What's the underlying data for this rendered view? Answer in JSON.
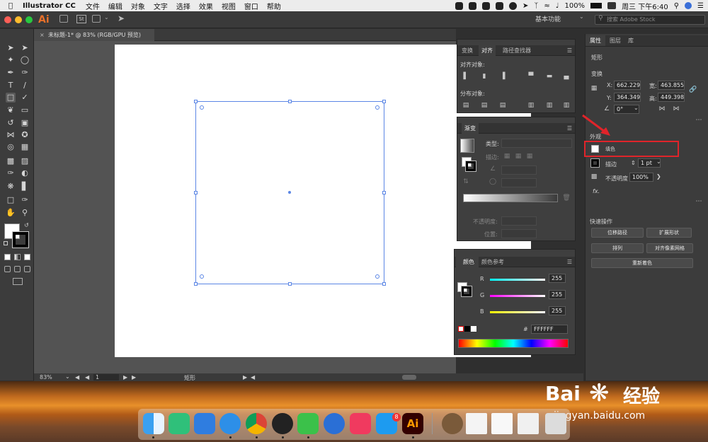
{
  "menubar": {
    "app": "Illustrator CC",
    "items": [
      "文件",
      "编辑",
      "对象",
      "文字",
      "选择",
      "效果",
      "视图",
      "窗口",
      "帮助"
    ],
    "battery": "100%",
    "clock": "周三 下午6:40"
  },
  "titlebar": {
    "ai_logo": "Ai",
    "st_logo": "St",
    "workspace": "基本功能",
    "stock_search_placeholder": "搜索 Adobe Stock"
  },
  "document": {
    "tab_label": "未标题-1* @ 83% (RGB/GPU 预览)",
    "close": "×"
  },
  "status": {
    "zoom": "83%",
    "artboard_num": "1",
    "selection_label": "矩形"
  },
  "align_panel": {
    "tabs": [
      "变换",
      "对齐",
      "路径查找器"
    ],
    "align_objects_label": "对齐对象:",
    "distribute_objects_label": "分布对象:"
  },
  "gradient_panel": {
    "tab": "渐变",
    "type_label": "类型:",
    "stroke_label": "描边:",
    "opacity_label": "不透明度:",
    "position_label": "位置:"
  },
  "color_panel": {
    "tabs": [
      "颜色",
      "颜色参考"
    ],
    "r_label": "R",
    "r_value": "255",
    "g_label": "G",
    "g_value": "255",
    "b_label": "B",
    "b_value": "255",
    "hex_label": "#",
    "hex_value": "FFFFFF"
  },
  "properties_panel": {
    "tabs": [
      "属性",
      "图层",
      "库"
    ],
    "object_type": "矩形",
    "transform_label": "变换",
    "x_label": "X:",
    "x_value": "662.229",
    "y_label": "Y:",
    "y_value": "364.349",
    "w_label": "宽:",
    "w_value": "463.855",
    "h_label": "高:",
    "h_value": "449.398",
    "angle_value": "0°",
    "appearance_label": "外观",
    "fill_label": "填色",
    "stroke_label": "描边",
    "stroke_value": "1 pt",
    "opacity_label": "不透明度",
    "opacity_value": "100%",
    "fx_label": "fx.",
    "quick_actions_label": "快速操作",
    "offset_path_btn": "位移路径",
    "expand_shape_btn": "扩展形状",
    "arrange_btn": "排列",
    "align_pixel_btn": "对齐像素网格",
    "recolor_btn": "重新着色"
  },
  "watermark": {
    "brand": "Bai",
    "brand2": "经验",
    "url": "jingyan.baidu.com"
  },
  "dock": {
    "mail_badge": "8",
    "ai_label": "Ai"
  },
  "colors": {
    "accent_selection": "#5b86e5",
    "annotation_red": "#e0242a",
    "ai_orange": "#e8702a"
  }
}
